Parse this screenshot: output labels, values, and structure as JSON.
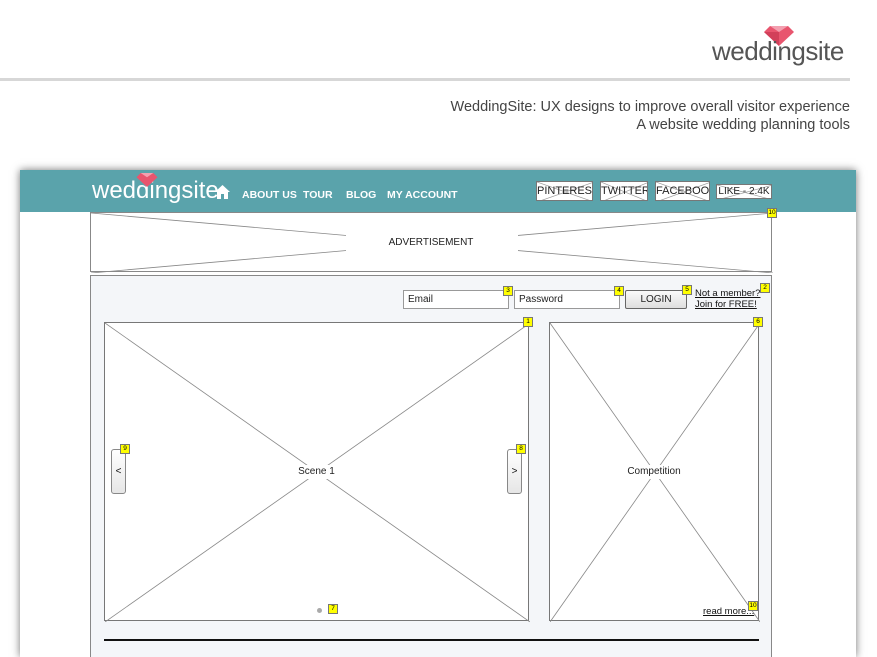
{
  "brand": {
    "name": "weddingsite",
    "accent": "#e8556e"
  },
  "slide": {
    "subtitle_line1": "WeddingSite: UX designs to improve overall visitor experience",
    "subtitle_line2": "A website wedding planning tools"
  },
  "wireframe": {
    "navbar_color": "#5aa3ab",
    "logo": "weddingsite",
    "nav": {
      "home_icon": "home-icon",
      "items": [
        "ABOUT US",
        "TOUR",
        "BLOG",
        "MY ACCOUNT"
      ]
    },
    "social": {
      "pinterest": "PINTEREST",
      "twitter": "TWITTER",
      "facebook": "FACEBOOK",
      "like": "LIKE - 2.4K"
    },
    "advertisement": "ADVERTISEMENT",
    "login": {
      "email_placeholder": "Email",
      "password_placeholder": "Password",
      "button": "LOGIN",
      "not_member": "Not a member?",
      "join": "Join for FREE!"
    },
    "slider": {
      "label": "Scene 1",
      "prev": "<",
      "next": ">"
    },
    "competition": {
      "label": "Competition",
      "read_more": "read more..."
    },
    "badges": {
      "b1": "1",
      "b2": "2",
      "b3": "3",
      "b4": "4",
      "b5": "5",
      "b6": "6",
      "b7": "7",
      "b8": "8",
      "b9": "9",
      "b10a": "10",
      "b10b": "10"
    }
  }
}
